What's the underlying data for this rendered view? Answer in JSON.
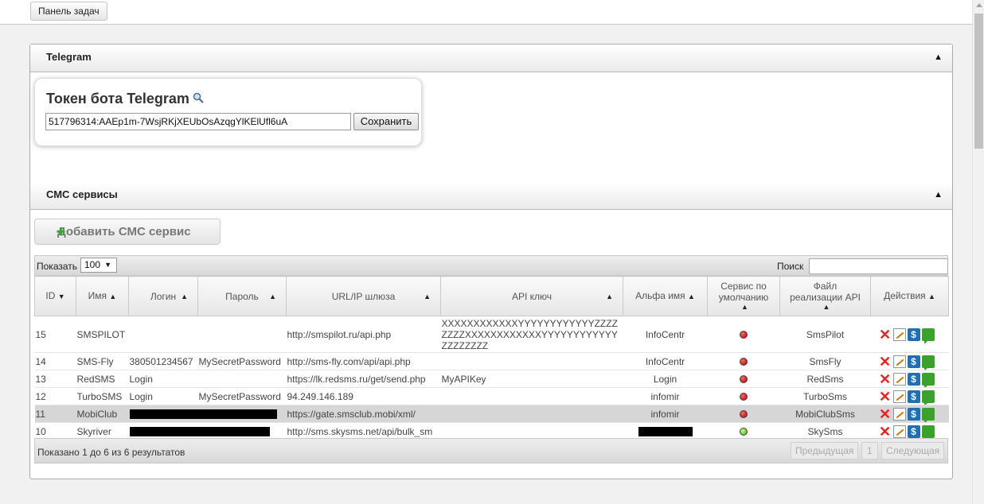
{
  "topbar": {
    "task_panel_label": "Панель задач"
  },
  "telegram": {
    "section_title": "Telegram",
    "collapse_icon": "triangle-up-icon",
    "token_title": "Токен бота Telegram",
    "token_value": "517796314:AAEp1m-7WsjRKjXEUbOsAzqgYlKElUfl6uA",
    "save_label": "Сохранить"
  },
  "sms": {
    "section_title": "СМС сервисы",
    "add_label": "Добавить СМС сервис",
    "show_label": "Показать",
    "show_value": "100",
    "search_label": "Поиск",
    "search_value": "",
    "columns": [
      "ID",
      "Имя",
      "Логин",
      "Пароль",
      "URL/IP шлюза",
      "API ключ",
      "Альфа имя",
      "Сервис по умолчанию",
      "Файл реализации API",
      "Действия"
    ],
    "rows": [
      {
        "id": "15",
        "name": "SMSPILOT",
        "login": "",
        "password": "",
        "url": "http://smspilot.ru/api.php",
        "api_key": "XXXXXXXXXXXXYYYYYYYYYYYYZZZZZZZZXXXXXXXXXXXXYYYYYYYYYYYYZZZZZZZZ",
        "alpha": "InfoCentr",
        "default_status": "red",
        "api_file": "SmsPilot"
      },
      {
        "id": "14",
        "name": "SMS-Fly",
        "login": "380501234567",
        "password": "MySecretPassword",
        "url": "http://sms-fly.com/api/api.php",
        "api_key": "",
        "alpha": "InfoCentr",
        "default_status": "red",
        "api_file": "SmsFly"
      },
      {
        "id": "13",
        "name": "RedSMS",
        "login": "Login",
        "password": "",
        "url": "https://lk.redsms.ru/get/send.php",
        "api_key": "MyAPIKey",
        "alpha": "Login",
        "default_status": "red",
        "api_file": "RedSms"
      },
      {
        "id": "12",
        "name": "TurboSMS",
        "login": "Login",
        "password": "MySecretPassword",
        "url": "94.249.146.189",
        "api_key": "",
        "alpha": "infomir",
        "default_status": "red",
        "api_file": "TurboSms"
      },
      {
        "id": "11",
        "name": "MobiClub",
        "login": "",
        "password": "",
        "url": "https://gate.smsclub.mobi/xml/",
        "api_key": "",
        "alpha": "infomir",
        "default_status": "red",
        "api_file": "MobiClubSms"
      },
      {
        "id": "10",
        "name": "Skyriver",
        "login": "",
        "password": "",
        "url": "http://sms.skysms.net/api/bulk_sm",
        "api_key": "",
        "alpha": "",
        "default_status": "green",
        "api_file": "SkySms"
      }
    ],
    "info_text": "Показано 1 до 6 из 6 результатов",
    "prev_label": "Предыдущая",
    "page_label": "1",
    "next_label": "Следующая",
    "action_icons": [
      "delete-icon",
      "edit-icon",
      "billing-icon",
      "message-icon"
    ]
  }
}
